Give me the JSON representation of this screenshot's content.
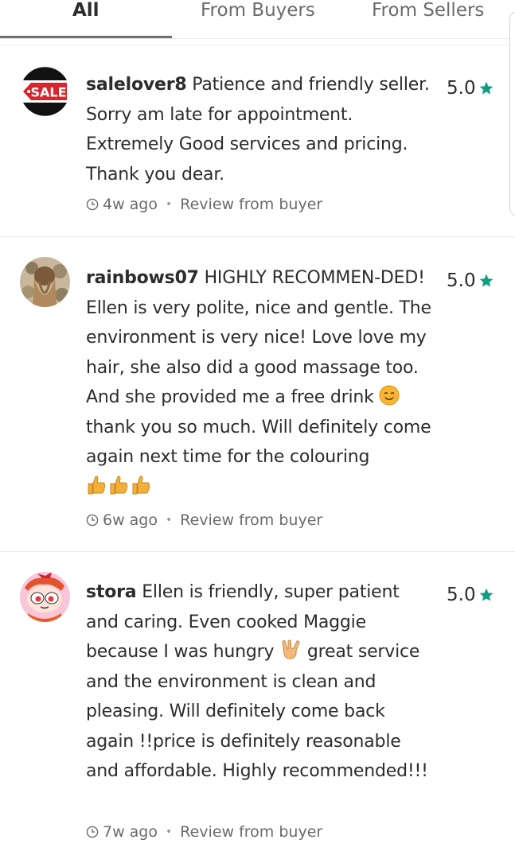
{
  "tabs": [
    {
      "label": "All",
      "active": true
    },
    {
      "label": "From Buyers",
      "active": false
    },
    {
      "label": "From Sellers",
      "active": false
    }
  ],
  "colors": {
    "star": "#0f9d83",
    "text": "#2c2c2c",
    "muted": "#6b6b6b"
  },
  "reviews": [
    {
      "username": "salelover8",
      "text_1": " Patience and friendly seller. Sorry am late for appointment. Extremely Good services and pricing. Thank you dear.",
      "rating": "5.0",
      "time": "4w ago",
      "source": "Review from buyer",
      "avatar": "sale-badge-avatar",
      "avatar_text": "SALE"
    },
    {
      "username": "rainbows07",
      "text_1": " HIGHLY RECOMMEN-DED! Ellen is very polite, nice and gentle. The environment is very nice! Love love my hair, she also did a good massage too. And she provided me a free drink ",
      "text_2": " thank you so much. Will definitely come again next time for the colouring ",
      "rating": "5.0",
      "time": "6w ago",
      "source": "Review from buyer",
      "avatar": "hair-photo-avatar"
    },
    {
      "username": "stora",
      "text_1": " Ellen is friendly, super patient and caring. Even cooked Maggie because I was hungry ",
      "text_2": " great service and the environment is clean and pleasing. Will definitely come back again !!price is definitely reasonable and affordable. Highly recommended!!!",
      "rating": "5.0",
      "time": "7w ago",
      "source": "Review from buyer",
      "avatar": "cartoon-avatar"
    }
  ]
}
